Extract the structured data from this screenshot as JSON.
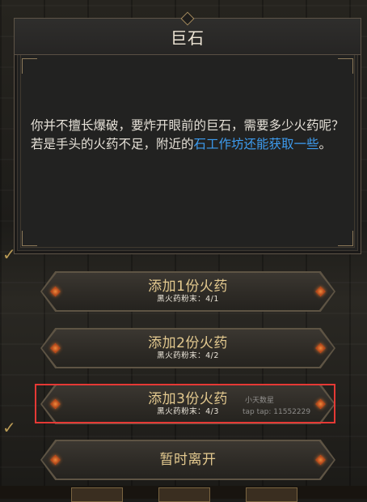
{
  "dialog": {
    "title": "巨石",
    "text_before_link": "你并不擅长爆破，要炸开眼前的巨石，需要多少火药呢？",
    "text_line2_before": "若是手头的火药不足，附近的",
    "link_text": "石工作坊还能获取一些",
    "text_after_link": "。"
  },
  "options": [
    {
      "label": "添加1份火药",
      "requirement": "黑火药粉末：4/1"
    },
    {
      "label": "添加2份火药",
      "requirement": "黑火药粉末：4/2"
    },
    {
      "label": "添加3份火药",
      "requirement": "黑火药粉末：4/3"
    }
  ],
  "leave_button": {
    "label": "暂时离开"
  },
  "watermark": {
    "line1": "小天数星",
    "line2": "tap tap: 11552229"
  },
  "colors": {
    "link": "#3d9cf0",
    "option_label": "#e3c98f",
    "highlight": "#e53935",
    "gem": "#e0702a"
  },
  "icons": [
    "check-icon",
    "diamond-gem-icon"
  ]
}
